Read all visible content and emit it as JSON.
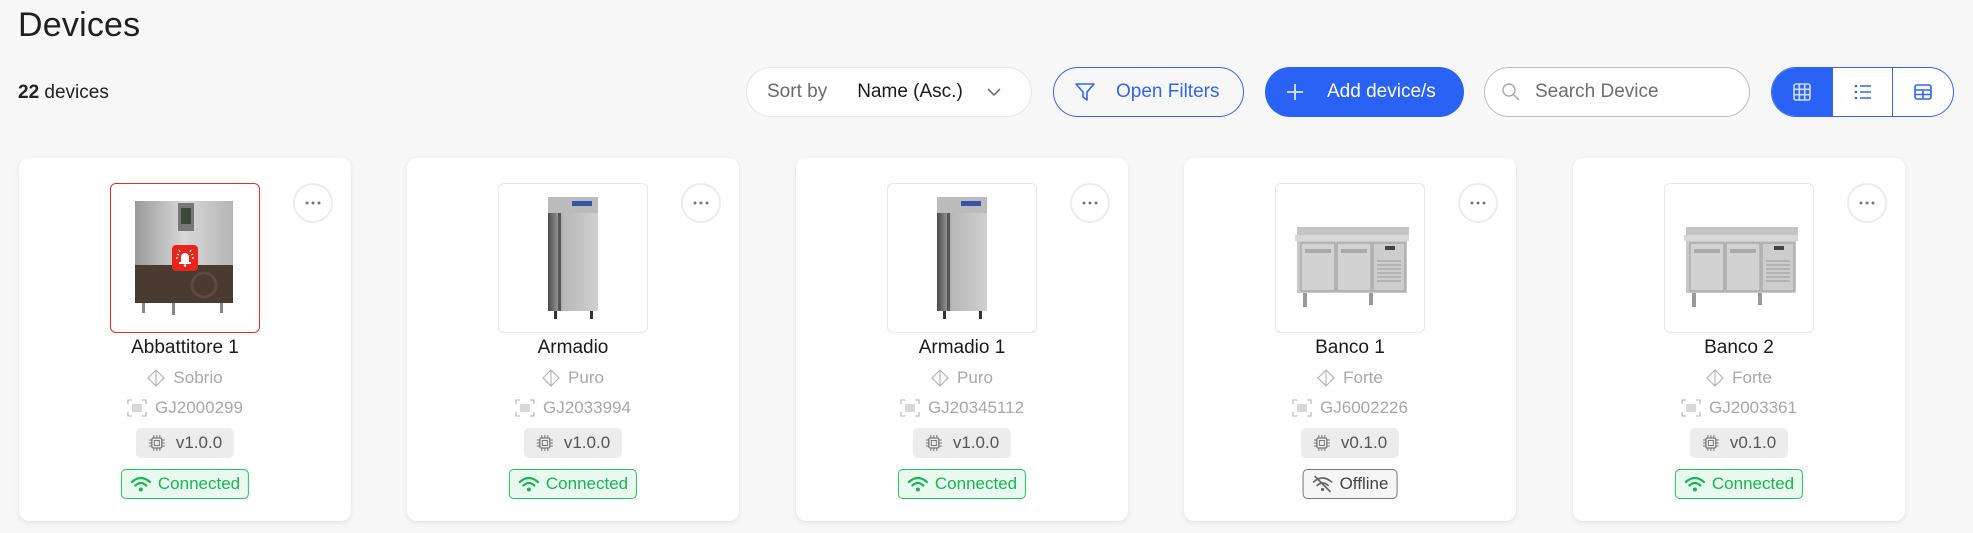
{
  "header": {
    "title": "Devices",
    "count_number": "22",
    "count_label": "devices"
  },
  "toolbar": {
    "sort_label": "Sort by",
    "sort_value": "Name (Asc.)",
    "filters_label": "Open Filters",
    "add_label": "Add device/s",
    "search_placeholder": "Search Device",
    "search_value": "",
    "views": [
      {
        "name": "grid-view",
        "active": true
      },
      {
        "name": "list-view",
        "active": false
      },
      {
        "name": "table-view",
        "active": false
      }
    ]
  },
  "colors": {
    "accent": "#2b62f6",
    "connected": "#14b84f",
    "offline": "#444444",
    "alarm": "#e0301e"
  },
  "devices": [
    {
      "name": "Abbattitore 1",
      "model": "Sobrio",
      "serial": "GJ2000299",
      "firmware": "v1.0.0",
      "status": "Connected",
      "status_key": "connected",
      "image": "blast-chiller",
      "alarm": true
    },
    {
      "name": "Armadio",
      "model": "Puro",
      "serial": "GJ2033994",
      "firmware": "v1.0.0",
      "status": "Connected",
      "status_key": "connected",
      "image": "upright-cabinet",
      "alarm": false
    },
    {
      "name": "Armadio 1",
      "model": "Puro",
      "serial": "GJ20345112",
      "firmware": "v1.0.0",
      "status": "Connected",
      "status_key": "connected",
      "image": "upright-cabinet",
      "alarm": false
    },
    {
      "name": "Banco 1",
      "model": "Forte",
      "serial": "GJ6002226",
      "firmware": "v0.1.0",
      "status": "Offline",
      "status_key": "offline",
      "image": "counter-fridge",
      "alarm": false
    },
    {
      "name": "Banco 2",
      "model": "Forte",
      "serial": "GJ2003361",
      "firmware": "v0.1.0",
      "status": "Connected",
      "status_key": "connected",
      "image": "counter-fridge",
      "alarm": false
    }
  ]
}
